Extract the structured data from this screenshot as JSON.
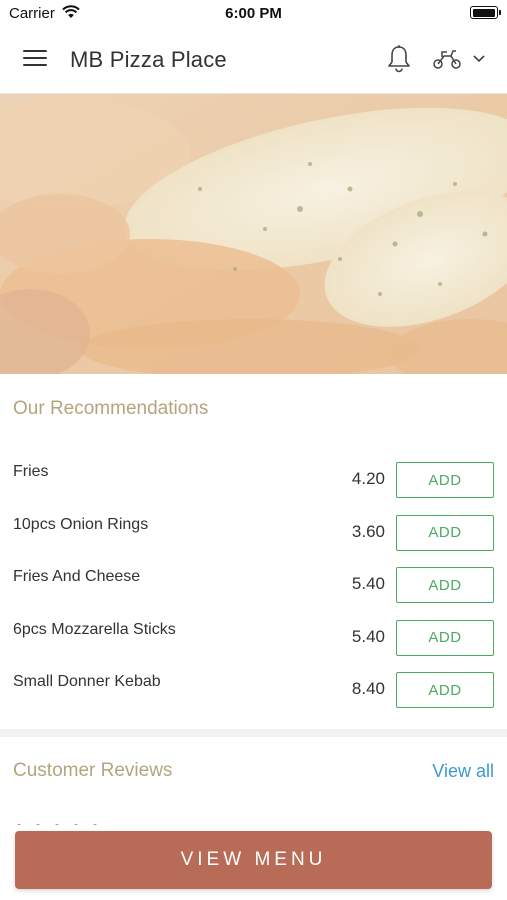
{
  "status_bar": {
    "carrier": "Carrier",
    "time": "6:00 PM",
    "battery_level": 1.0
  },
  "header": {
    "title": "MB Pizza Place",
    "icons": [
      "menu-icon",
      "bell-icon",
      "scooter-icon",
      "chevron-down-icon"
    ]
  },
  "hero": {
    "image": "pizza-cheese-close-up"
  },
  "recommendations": {
    "title": "Our Recommendations",
    "items": [
      {
        "name": "Fries",
        "price": "4.20",
        "action": "ADD"
      },
      {
        "name": "10pcs Onion Rings",
        "price": "3.60",
        "action": "ADD"
      },
      {
        "name": "Fries And Cheese",
        "price": "5.40",
        "action": "ADD"
      },
      {
        "name": "6pcs Mozzarella Sticks",
        "price": "5.40",
        "action": "ADD"
      },
      {
        "name": "Small Donner Kebab",
        "price": "8.40",
        "action": "ADD"
      }
    ]
  },
  "reviews": {
    "title": "Customer Reviews",
    "view_all": "View all"
  },
  "footer": {
    "view_menu": "VIEW MENU"
  },
  "colors": {
    "accent_button": "#b86b57",
    "add_green": "#4caa61",
    "section_title": "#b3a57d",
    "link_blue": "#3a9ad0"
  }
}
